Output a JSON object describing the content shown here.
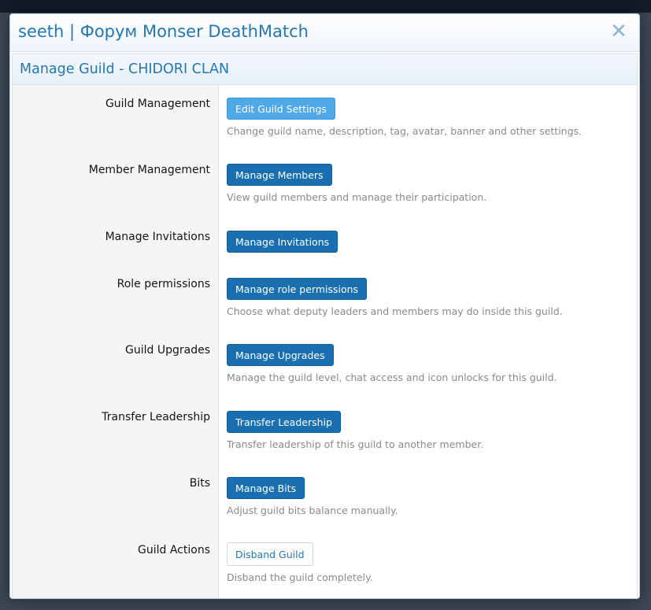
{
  "window": {
    "title": "seeth | Форум Monser DeathMatch",
    "close_label": "✕"
  },
  "section": {
    "title": "Manage Guild - CHIDORI CLAN"
  },
  "rows": [
    {
      "label": "Guild Management",
      "button": "Edit Guild Settings",
      "description": "Change guild name, description, tag, avatar, banner and other settings."
    },
    {
      "label": "Member Management",
      "button": "Manage Members",
      "description": "View guild members and manage their participation."
    },
    {
      "label": "Manage Invitations",
      "button": "Manage Invitations",
      "description": ""
    },
    {
      "label": "Role permissions",
      "button": "Manage role permissions",
      "description": "Choose what deputy leaders and members may do inside this guild."
    },
    {
      "label": "Guild Upgrades",
      "button": "Manage Upgrades",
      "description": "Manage the guild level, chat access and icon unlocks for this guild."
    },
    {
      "label": "Transfer Leadership",
      "button": "Transfer Leadership",
      "description": "Transfer leadership of this guild to another member."
    },
    {
      "label": "Bits",
      "button": "Manage Bits",
      "description": "Adjust guild bits balance manually."
    },
    {
      "label": "Guild Actions",
      "button": "Disband Guild",
      "description": "Disband the guild completely."
    }
  ],
  "colors": {
    "accent": "#2577b1",
    "primary_button": "#1a6fb0",
    "highlight_button": "#4fa8e8"
  }
}
